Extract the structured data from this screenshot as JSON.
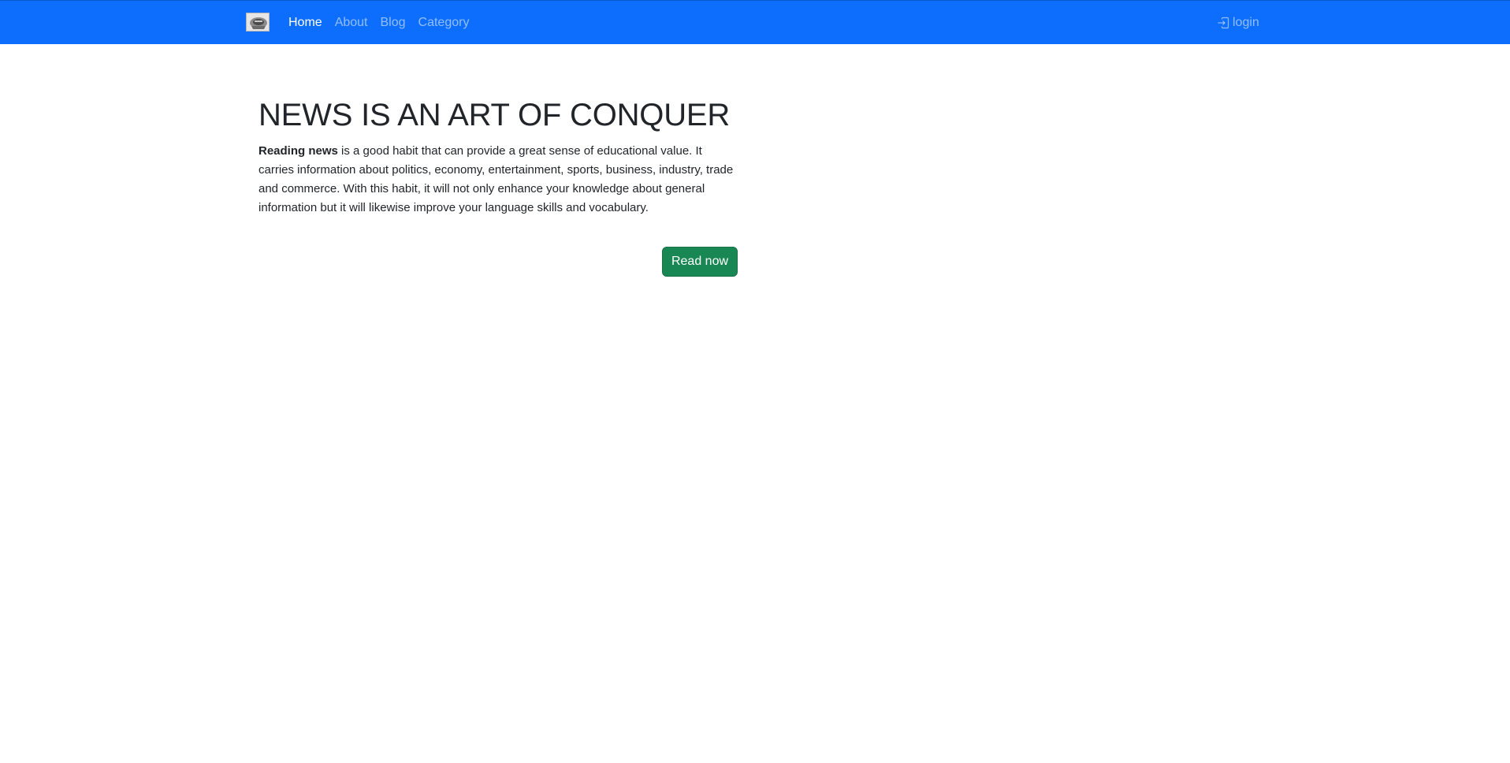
{
  "navbar": {
    "brand_icon": "newspaper-logo-icon",
    "bg_color": "#0d6efd",
    "links": [
      {
        "label": "Home",
        "active": true
      },
      {
        "label": "About",
        "active": false
      },
      {
        "label": "Blog",
        "active": false
      },
      {
        "label": "Category",
        "active": false
      }
    ],
    "login": {
      "label": "login",
      "icon": "box-arrow-in-right-icon"
    }
  },
  "hero": {
    "title": "NEWS IS AN ART OF CONQUER",
    "lead_bold": "Reading news",
    "lead_text": " is a good habit that can provide a great sense of educational value. It carries information about politics, economy, entertainment, sports, business, industry, trade and commerce. With this habit, it will not only enhance your knowledge about general information but it will likewise improve your language skills and vocabulary.",
    "button_label": "Read now",
    "button_color": "#198754"
  }
}
